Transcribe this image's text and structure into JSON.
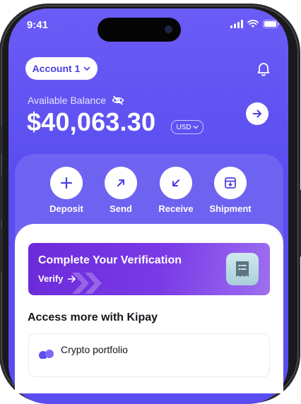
{
  "status_bar": {
    "time": "9:41"
  },
  "header": {
    "account_label": "Account 1",
    "balance_label": "Available Balance",
    "balance_amount": "$40,063.30",
    "currency": "USD"
  },
  "actions": [
    {
      "label": "Deposit",
      "icon": "plus-icon"
    },
    {
      "label": "Send",
      "icon": "arrow-up-right-icon"
    },
    {
      "label": "Receive",
      "icon": "arrow-down-left-icon"
    },
    {
      "label": "Shipment",
      "icon": "package-icon"
    }
  ],
  "verification_card": {
    "title": "Complete Your Verification",
    "link_label": "Verify"
  },
  "access_section": {
    "title": "Access more with Kipay",
    "items": [
      {
        "label": "Crypto portfolio"
      }
    ]
  },
  "colors": {
    "primary": "#5b4ef0",
    "card_gradient_start": "#6c2bd9",
    "card_gradient_end": "#9d6ff0"
  }
}
